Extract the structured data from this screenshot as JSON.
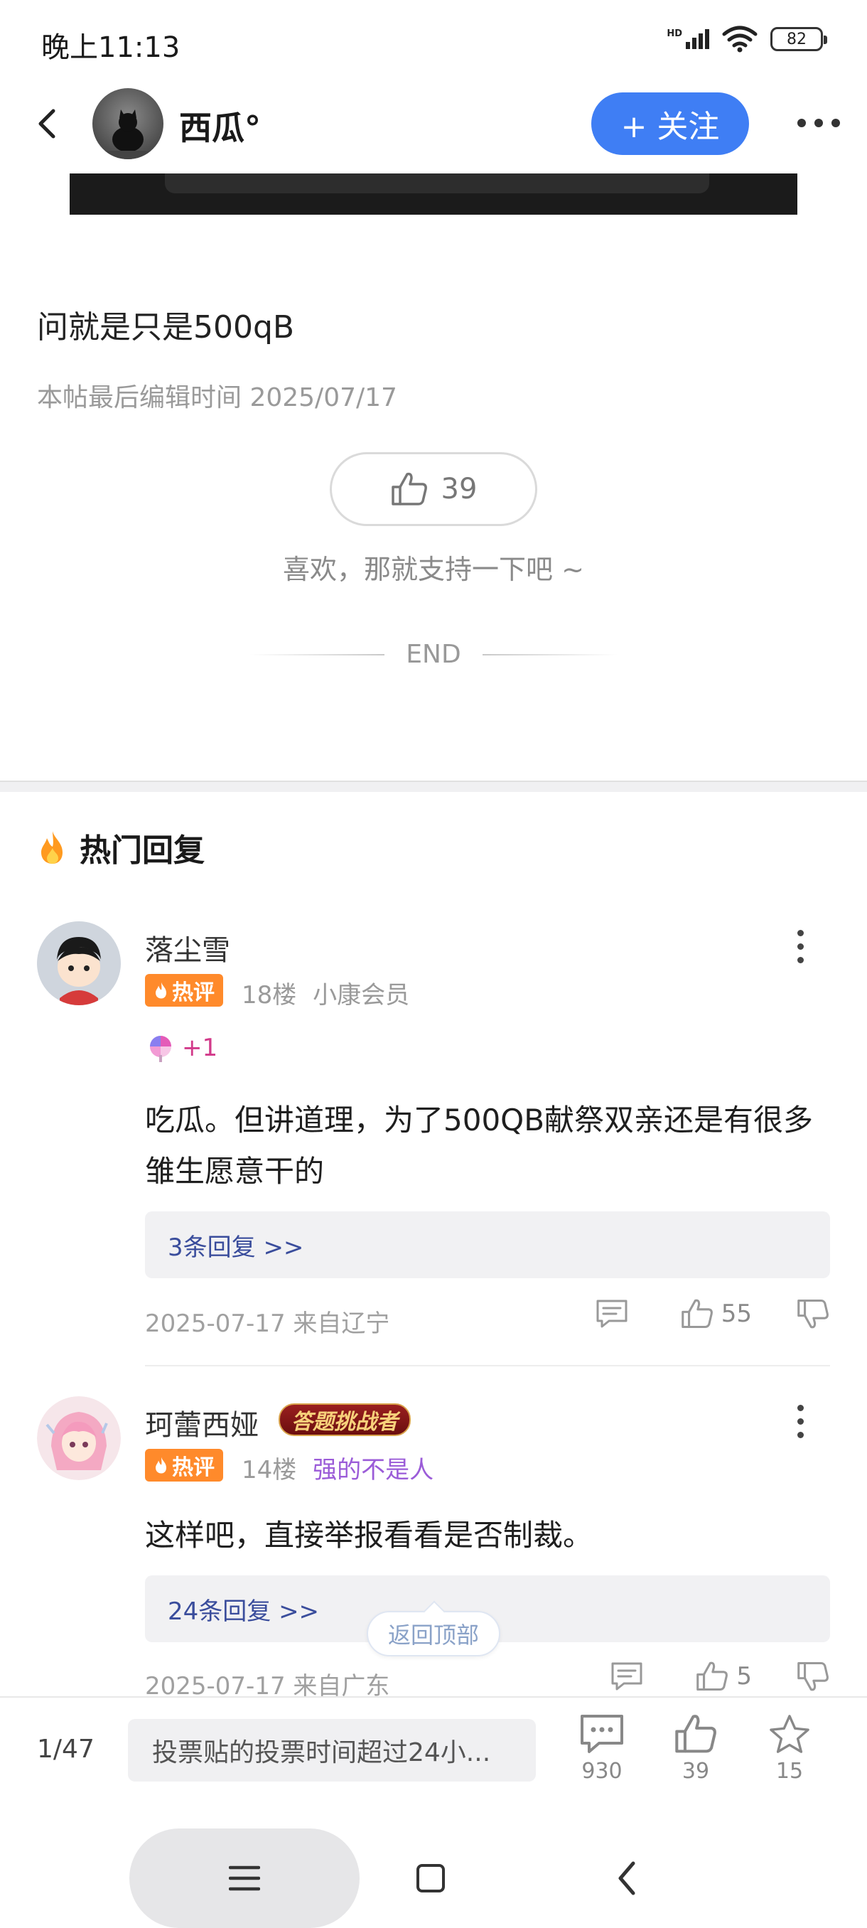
{
  "status_bar": {
    "time": "晚上11:13",
    "network": "HD",
    "battery": "82"
  },
  "header": {
    "username": "西瓜°",
    "follow_label": "+ 关注"
  },
  "post": {
    "text": "问就是只是500qB",
    "edit_time": "本帖最后编辑时间 2025/07/17",
    "like_count": "39",
    "like_hint": "喜欢，那就支持一下吧 ~",
    "end_label": "END"
  },
  "hot_replies": {
    "title": "热门回复",
    "items": [
      {
        "name": "落尘雪",
        "badge": "热评",
        "floor": "18楼",
        "level": "小康会员",
        "gift_count": "+1",
        "text": "吃瓜。但讲道理，为了500QB献祭双亲还是有很多雏生愿意干的",
        "replies_label": "3条回复 >>",
        "date": "2025-07-17 来自辽宁",
        "likes": "55"
      },
      {
        "name": "珂蕾西娅",
        "title_badge": "答题挑战者",
        "badge": "热评",
        "floor": "14楼",
        "level": "强的不是人",
        "text": "这样吧，直接举报看看是否制裁。",
        "replies_label": "24条回复 >>",
        "date": "2025-07-17 来自广东",
        "likes": "5"
      }
    ]
  },
  "back_to_top": "返回顶部",
  "bottom_bar": {
    "page": "1/47",
    "input_text": "投票贴的投票时间超过24小...",
    "comments": "930",
    "likes": "39",
    "favorites": "15"
  }
}
